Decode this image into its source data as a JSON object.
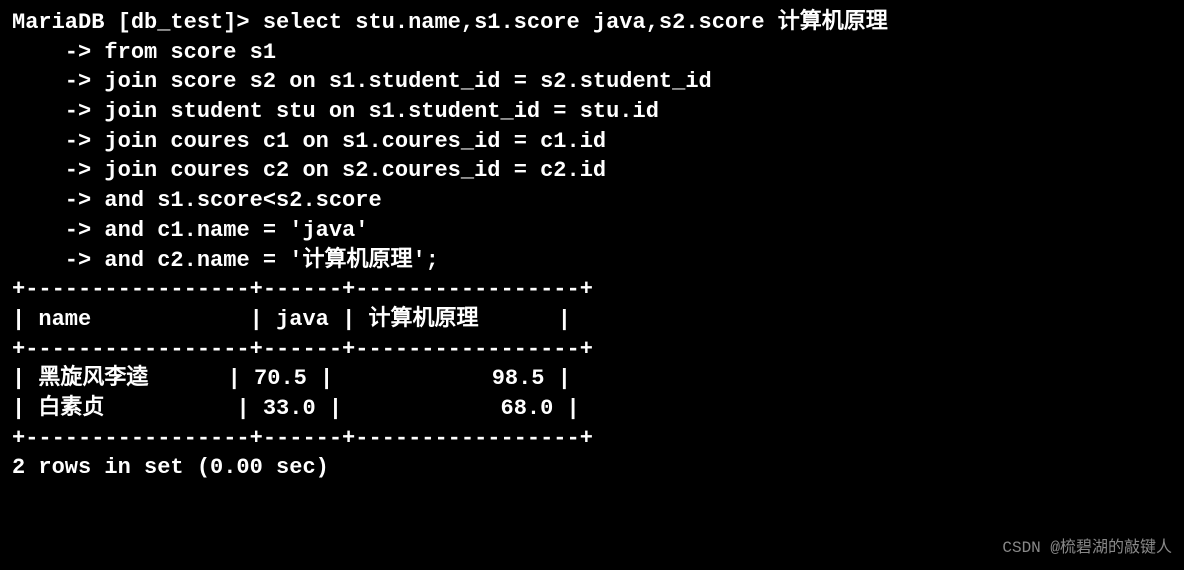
{
  "prompt_prefix": "MariaDB [db_test]> ",
  "continuation_prefix": "    -> ",
  "query_lines": [
    "select stu.name,s1.score java,s2.score 计算机原理",
    "from score s1",
    "join score s2 on s1.student_id = s2.student_id",
    "join student stu on s1.student_id = stu.id",
    "join coures c1 on s1.coures_id = c1.id",
    "join coures c2 on s2.coures_id = c2.id",
    "and s1.score<s2.score",
    "and c1.name = 'java'",
    "and c2.name = '计算机原理';"
  ],
  "table": {
    "border_line": "+-----------------+------+-----------------+",
    "headers": [
      "name",
      "java",
      "计算机原理"
    ],
    "rows": [
      {
        "name": "黑旋风李逵",
        "java": "70.5",
        "principle": "98.5"
      },
      {
        "name": "白素贞",
        "java": "33.0",
        "principle": "68.0"
      }
    ]
  },
  "status_line": "2 rows in set (0.00 sec)",
  "watermark": "CSDN @梳碧湖的敲键人"
}
